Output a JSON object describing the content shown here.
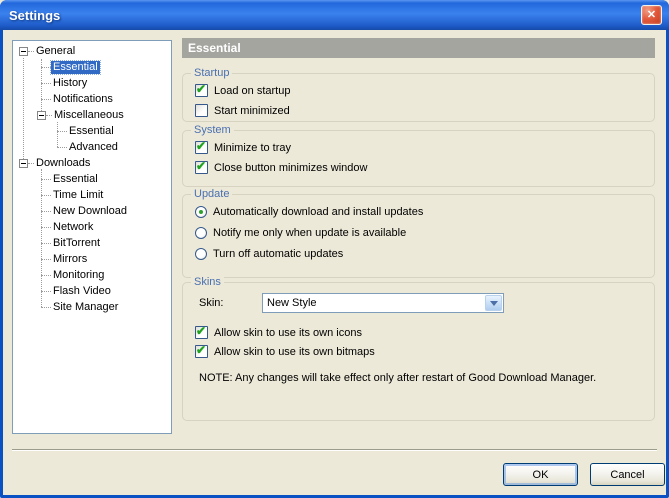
{
  "window": {
    "title": "Settings"
  },
  "icons": {
    "close": "✕",
    "check": "✔"
  },
  "panel": {
    "header": "Essential"
  },
  "tree": {
    "items": [
      {
        "label": "General",
        "level": 0,
        "expanded": true
      },
      {
        "label": "Essential",
        "level": 1,
        "selected": true
      },
      {
        "label": "History",
        "level": 1
      },
      {
        "label": "Notifications",
        "level": 1
      },
      {
        "label": "Miscellaneous",
        "level": 1,
        "expanded": true
      },
      {
        "label": "Essential",
        "level": 2
      },
      {
        "label": "Advanced",
        "level": 2
      },
      {
        "label": "Downloads",
        "level": 0,
        "expanded": true
      },
      {
        "label": "Essential",
        "level": 1
      },
      {
        "label": "Time Limit",
        "level": 1
      },
      {
        "label": "New Download",
        "level": 1
      },
      {
        "label": "Network",
        "level": 1
      },
      {
        "label": "BitTorrent",
        "level": 1
      },
      {
        "label": "Mirrors",
        "level": 1
      },
      {
        "label": "Monitoring",
        "level": 1
      },
      {
        "label": "Flash Video",
        "level": 1
      },
      {
        "label": "Site Manager",
        "level": 1
      }
    ]
  },
  "groups": {
    "startup": {
      "title": "Startup",
      "checkboxes": [
        {
          "label": "Load on startup",
          "checked": true
        },
        {
          "label": "Start minimized",
          "checked": false
        }
      ]
    },
    "system": {
      "title": "System",
      "checkboxes": [
        {
          "label": "Minimize to tray",
          "checked": true
        },
        {
          "label": "Close button minimizes window",
          "checked": true
        }
      ]
    },
    "update": {
      "title": "Update",
      "radios": [
        {
          "label": "Automatically download and install updates",
          "selected": true
        },
        {
          "label": "Notify me only when update is available",
          "selected": false
        },
        {
          "label": "Turn off automatic updates",
          "selected": false
        }
      ]
    },
    "skins": {
      "title": "Skins",
      "skin_label": "Skin:",
      "skin_value": "New Style",
      "checkboxes": [
        {
          "label": "Allow skin to use its own icons",
          "checked": true
        },
        {
          "label": "Allow skin to use its own bitmaps",
          "checked": true
        }
      ],
      "note": "NOTE: Any changes will take effect only after restart of Good Download Manager."
    }
  },
  "footer": {
    "ok_label": "OK",
    "cancel_label": "Cancel"
  },
  "colors": {
    "titlebar_blue": "#2E77E8",
    "window_border": "#0A52C4",
    "background_tan": "#ECE9D8",
    "header_gray": "#A5A5A0",
    "selection_blue": "#316AC5",
    "group_label_blue": "#4A70B0",
    "check_green": "#1FA31F",
    "combo_border": "#7F9DB9"
  }
}
